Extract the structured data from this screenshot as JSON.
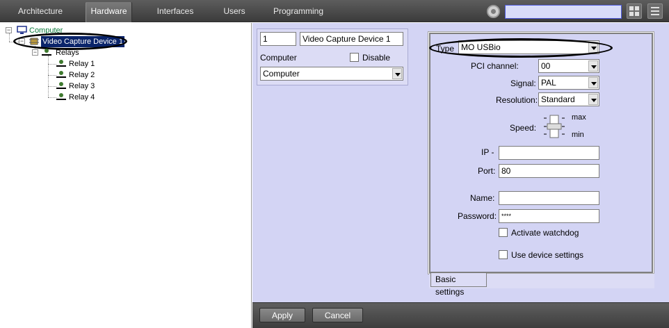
{
  "top_tabs": [
    "Architecture",
    "Hardware",
    "Interfaces",
    "Users",
    "Programming"
  ],
  "active_tab": "Hardware",
  "icons": {
    "settings": "circle-gear-icon",
    "layout": "grid-icon",
    "menu": "menu-icon",
    "computer": "computer-icon",
    "device": "chip-icon",
    "relay": "relay-icon"
  },
  "tree": {
    "computer": "Computer",
    "device": "Video Capture Device 1",
    "relays": "Relays",
    "relay_items": [
      "Relay 1",
      "Relay 2",
      "Relay 3",
      "Relay 4"
    ]
  },
  "object_panel": {
    "id_value": "1",
    "name_value": "Video Capture Device 1",
    "computer_label": "Computer",
    "disable_label": "Disable",
    "computer_select": "Computer"
  },
  "settings": {
    "type_label": "Type",
    "type_value": "MO USBio",
    "pci_label": "PCI channel:",
    "pci_value": "00",
    "signal_label": "Signal:",
    "signal_value": "PAL",
    "resolution_label": "Resolution:",
    "resolution_value": "Standard",
    "speed_label": "Speed:",
    "speed_max": "max",
    "speed_min": "min",
    "ip_label": "IP -",
    "ip_value": "",
    "port_label": "Port:",
    "port_value": "80",
    "name_label": "Name:",
    "name_value": "",
    "password_label": "Password:",
    "password_value": "****",
    "watchdog_label": "Activate watchdog",
    "use_device_label": "Use device settings",
    "tab_label": "Basic settings"
  },
  "buttons": {
    "apply": "Apply",
    "cancel": "Cancel"
  }
}
